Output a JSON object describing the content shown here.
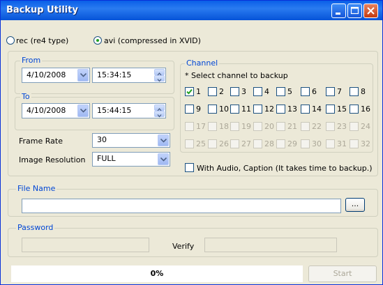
{
  "window": {
    "title": "Backup Utility"
  },
  "format": {
    "rec_label": "rec (re4 type)",
    "avi_label": "avi (compressed in XVID)",
    "selected": "avi"
  },
  "from": {
    "label": "From",
    "date": "4/10/2008",
    "time": "15:34:15"
  },
  "to": {
    "label": "To",
    "date": "4/10/2008",
    "time": "15:44:15"
  },
  "frame_rate": {
    "label": "Frame Rate",
    "value": "30"
  },
  "image_resolution": {
    "label": "Image Resolution",
    "value": "FULL"
  },
  "channel": {
    "label": "Channel",
    "hint": "* Select channel to backup",
    "channels": [
      {
        "n": "1",
        "checked": true,
        "enabled": true
      },
      {
        "n": "2",
        "checked": false,
        "enabled": true
      },
      {
        "n": "3",
        "checked": false,
        "enabled": true
      },
      {
        "n": "4",
        "checked": false,
        "enabled": true
      },
      {
        "n": "5",
        "checked": false,
        "enabled": true
      },
      {
        "n": "6",
        "checked": false,
        "enabled": true
      },
      {
        "n": "7",
        "checked": false,
        "enabled": true
      },
      {
        "n": "8",
        "checked": false,
        "enabled": true
      },
      {
        "n": "9",
        "checked": false,
        "enabled": true
      },
      {
        "n": "10",
        "checked": false,
        "enabled": true
      },
      {
        "n": "11",
        "checked": false,
        "enabled": true
      },
      {
        "n": "12",
        "checked": false,
        "enabled": true
      },
      {
        "n": "13",
        "checked": false,
        "enabled": true
      },
      {
        "n": "14",
        "checked": false,
        "enabled": true
      },
      {
        "n": "15",
        "checked": false,
        "enabled": true
      },
      {
        "n": "16",
        "checked": false,
        "enabled": true
      },
      {
        "n": "17",
        "checked": false,
        "enabled": false
      },
      {
        "n": "18",
        "checked": false,
        "enabled": false
      },
      {
        "n": "19",
        "checked": false,
        "enabled": false
      },
      {
        "n": "20",
        "checked": false,
        "enabled": false
      },
      {
        "n": "21",
        "checked": false,
        "enabled": false
      },
      {
        "n": "22",
        "checked": false,
        "enabled": false
      },
      {
        "n": "23",
        "checked": false,
        "enabled": false
      },
      {
        "n": "24",
        "checked": false,
        "enabled": false
      },
      {
        "n": "25",
        "checked": false,
        "enabled": false
      },
      {
        "n": "26",
        "checked": false,
        "enabled": false
      },
      {
        "n": "27",
        "checked": false,
        "enabled": false
      },
      {
        "n": "28",
        "checked": false,
        "enabled": false
      },
      {
        "n": "29",
        "checked": false,
        "enabled": false
      },
      {
        "n": "30",
        "checked": false,
        "enabled": false
      },
      {
        "n": "31",
        "checked": false,
        "enabled": false
      },
      {
        "n": "32",
        "checked": false,
        "enabled": false
      }
    ],
    "audio_caption_label": "With Audio, Caption (It takes time to backup.)",
    "audio_caption_checked": false
  },
  "file_name": {
    "label": "File Name",
    "value": "",
    "browse_label": "..."
  },
  "password": {
    "label": "Password",
    "value": "",
    "verify_label": "Verify",
    "verify_value": ""
  },
  "progress": {
    "percent": 0,
    "text": "0%"
  },
  "start_button": {
    "label": "Start",
    "enabled": false
  },
  "colors": {
    "title_bar": "#0A5FE8",
    "group_label": "#0046D5",
    "dialog_bg": "#ECE9D8"
  },
  "icons": {
    "minimize": "minimize-icon",
    "maximize": "maximize-icon",
    "close": "close-icon",
    "dropdown": "chevron-down-icon",
    "spinner": "spinner-arrows-icon",
    "checkmark": "checkmark-icon"
  }
}
